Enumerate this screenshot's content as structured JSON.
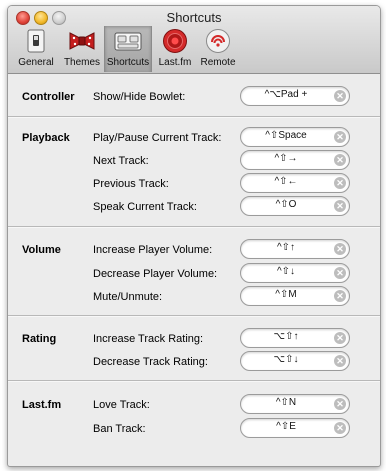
{
  "window": {
    "title": "Shortcuts"
  },
  "toolbar": [
    {
      "label": "General",
      "icon": "switch-icon"
    },
    {
      "label": "Themes",
      "icon": "bowtie-icon"
    },
    {
      "label": "Shortcuts",
      "icon": "keyboard-icon"
    },
    {
      "label": "Last.fm",
      "icon": "lastfm-icon"
    },
    {
      "label": "Remote",
      "icon": "remote-icon"
    }
  ],
  "groups": [
    {
      "name": "Controller",
      "rows": [
        {
          "label": "Show/Hide Bowlet:",
          "shortcut": "^⌥Pad +"
        }
      ]
    },
    {
      "name": "Playback",
      "rows": [
        {
          "label": "Play/Pause Current Track:",
          "shortcut": "^⇧Space"
        },
        {
          "label": "Next Track:",
          "shortcut": "^⇧→"
        },
        {
          "label": "Previous Track:",
          "shortcut": "^⇧←"
        },
        {
          "label": "Speak Current Track:",
          "shortcut": "^⇧O"
        }
      ]
    },
    {
      "name": "Volume",
      "rows": [
        {
          "label": "Increase Player Volume:",
          "shortcut": "^⇧↑"
        },
        {
          "label": "Decrease Player Volume:",
          "shortcut": "^⇧↓"
        },
        {
          "label": "Mute/Unmute:",
          "shortcut": "^⇧M"
        }
      ]
    },
    {
      "name": "Rating",
      "rows": [
        {
          "label": "Increase Track Rating:",
          "shortcut": "⌥⇧↑"
        },
        {
          "label": "Decrease Track Rating:",
          "shortcut": "⌥⇧↓"
        }
      ]
    },
    {
      "name": "Last.fm",
      "rows": [
        {
          "label": "Love Track:",
          "shortcut": "^⇧N"
        },
        {
          "label": "Ban Track:",
          "shortcut": "^⇧E"
        }
      ]
    }
  ],
  "clear_glyph": "✕",
  "colors": {
    "accent_red": "#d42a2a",
    "field_border": "#9b9b9b",
    "window_bg": "#ececec"
  }
}
